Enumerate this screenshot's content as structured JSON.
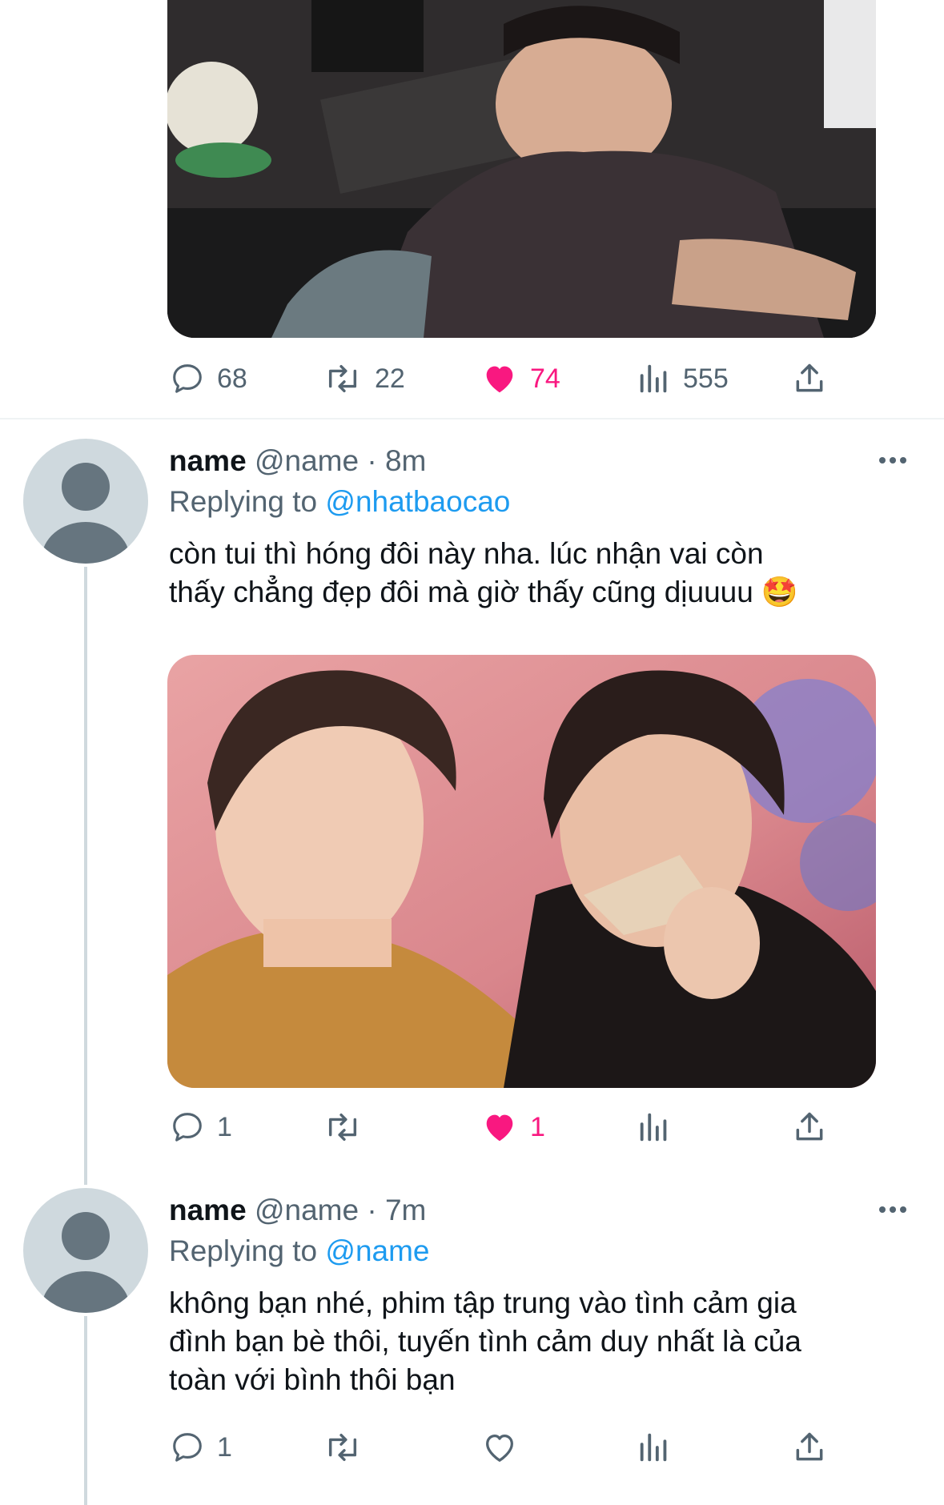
{
  "tweet_top": {
    "actions": {
      "replies": "68",
      "retweets": "22",
      "likes": "74",
      "views": "555"
    }
  },
  "reply1": {
    "display_name": "name",
    "handle": "@name",
    "separator": "·",
    "time": "8m",
    "replying_prefix": "Replying to",
    "replying_handle": "@nhatbaocao",
    "text_line1": "còn tui thì hóng đôi này nha. lúc nhận vai còn",
    "text_line2": "thấy chẳng đẹp đôi mà giờ thấy cũng dịuuuu",
    "emoji": "🤩",
    "actions": {
      "replies": "1",
      "retweets": "",
      "likes": "1",
      "views": ""
    }
  },
  "reply2": {
    "display_name": "name",
    "handle": "@name",
    "separator": "·",
    "time": "7m",
    "replying_prefix": "Replying to",
    "replying_handle": "@name",
    "text_line1": "không bạn nhé, phim tập trung vào tình cảm gia",
    "text_line2": "đình bạn bè thôi, tuyến tình cảm duy nhất là của",
    "text_line3": "toàn với bình thôi bạn",
    "actions": {
      "replies": "1",
      "retweets": "",
      "likes": "",
      "views": ""
    }
  },
  "colors": {
    "like_pink": "#f91880",
    "link_blue": "#1d9bf0",
    "muted_gray": "#536471",
    "divider": "#eff3f4"
  },
  "icons": [
    "reply-icon",
    "retweet-icon",
    "heart-icon",
    "views-icon",
    "share-icon",
    "more-icon",
    "avatar-icon"
  ]
}
